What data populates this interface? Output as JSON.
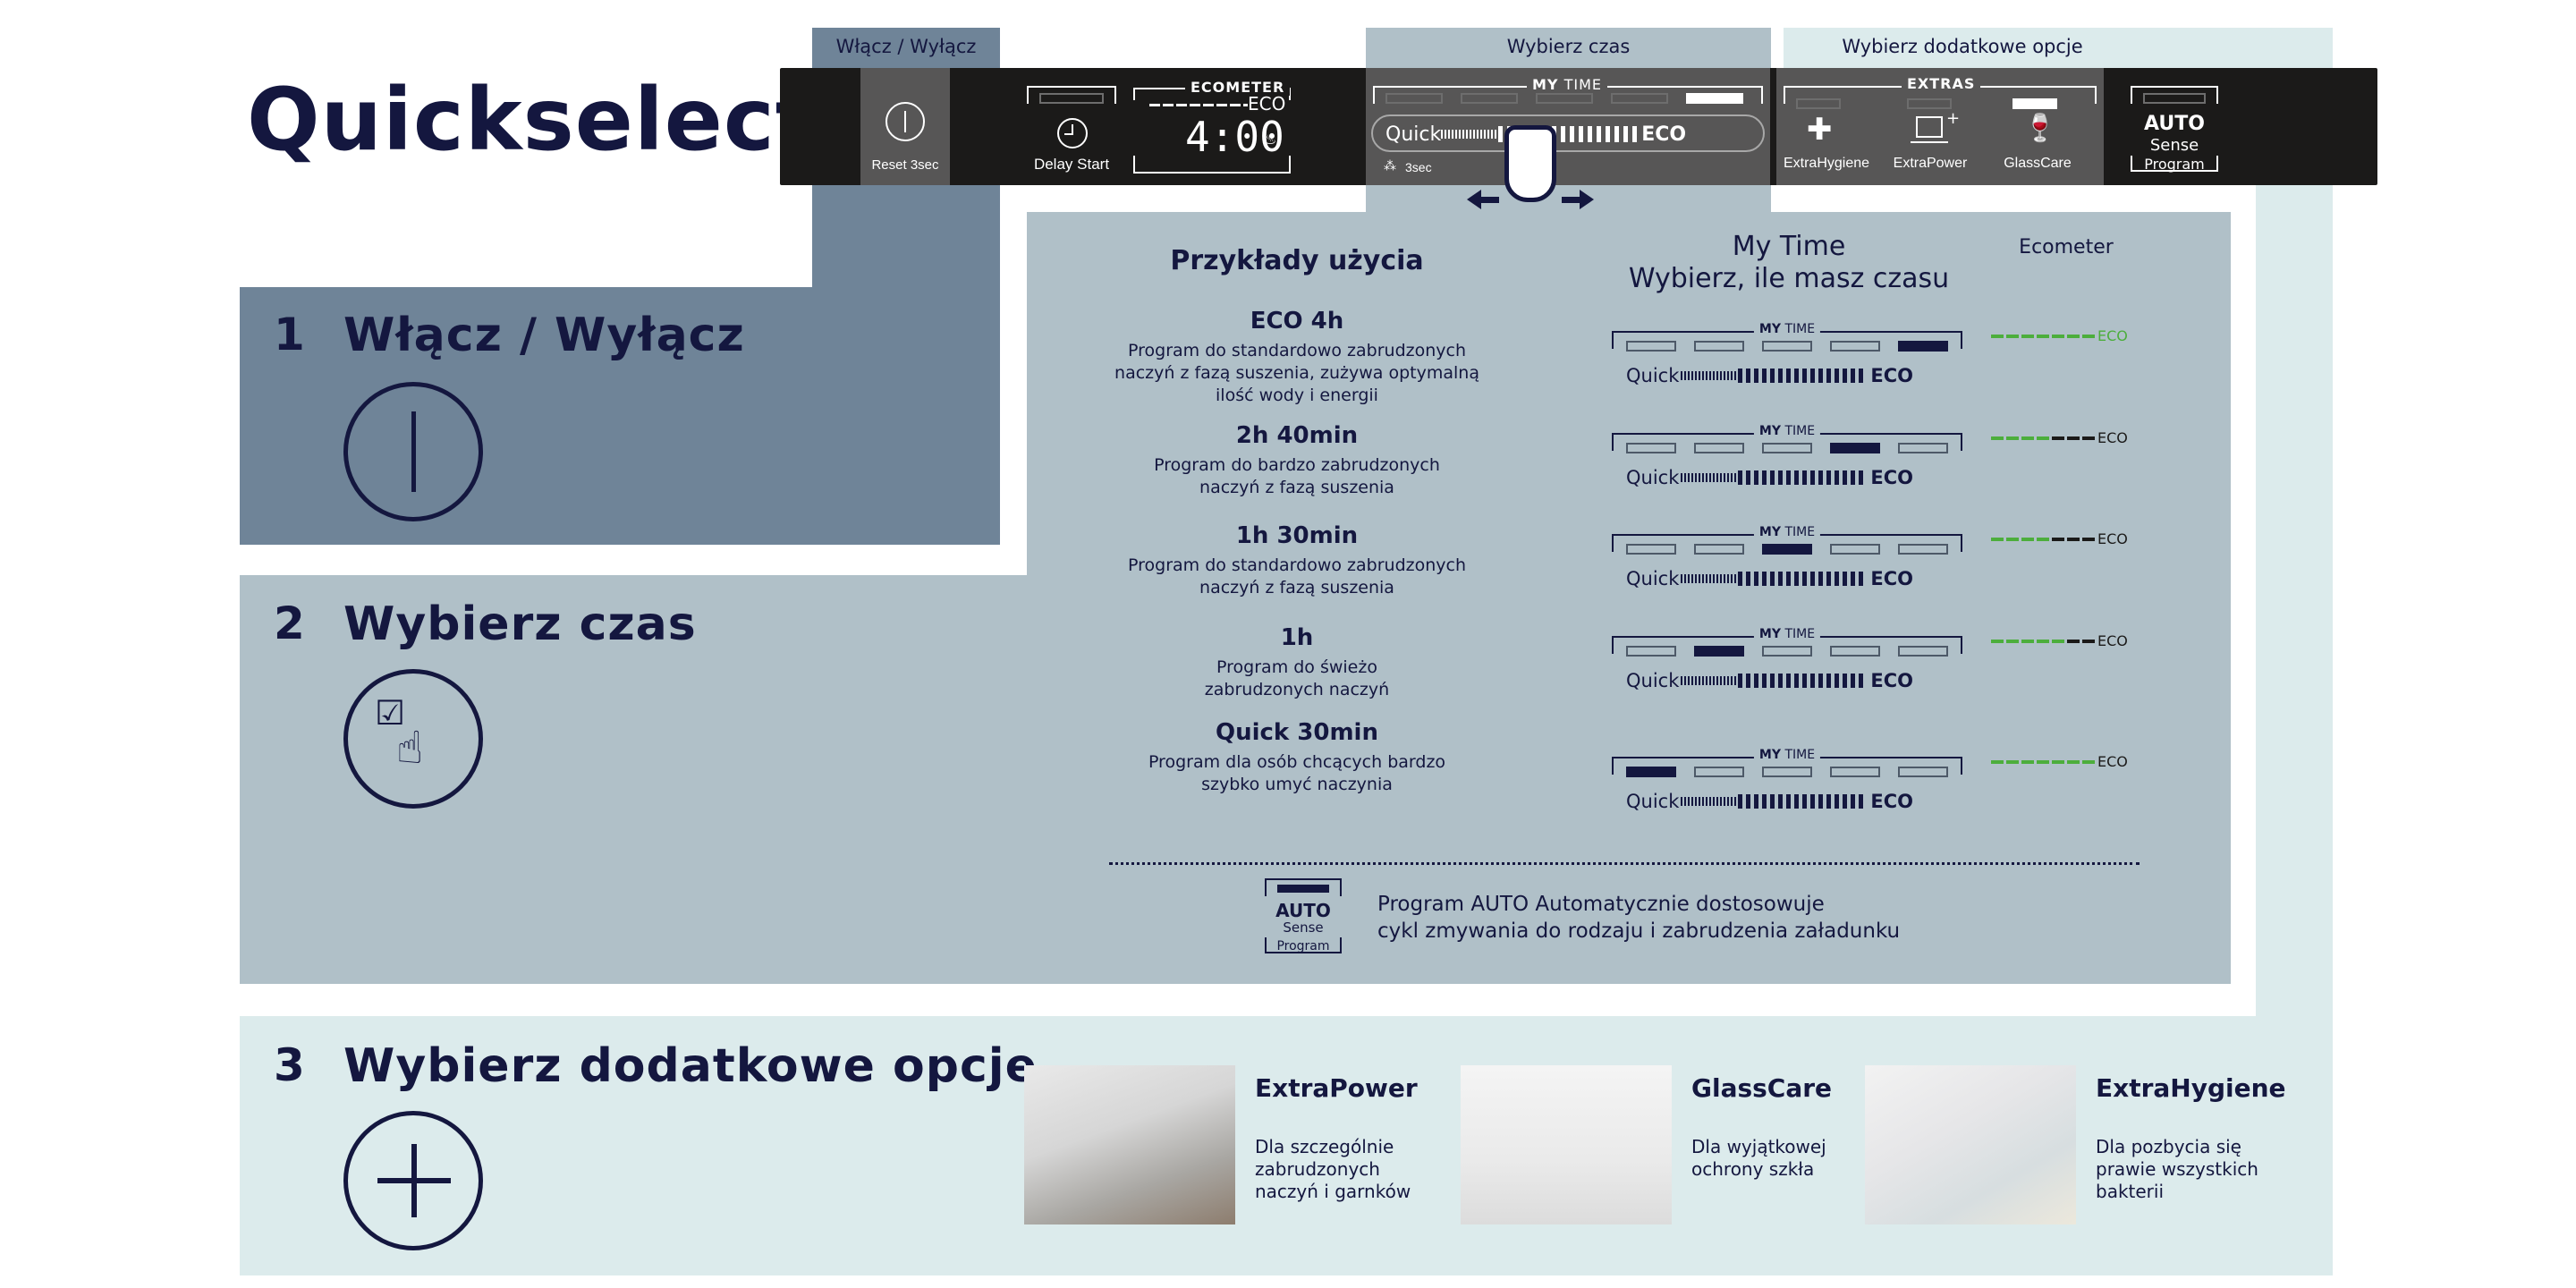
{
  "title": "Quickselect",
  "control_panel": {
    "power_header": "Włącz / Wyłącz",
    "time_header": "Wybierz czas",
    "options_header": "Wybierz dodatkowe opcje",
    "power_button": {
      "icon": "power-icon",
      "label": "Reset 3sec"
    },
    "delay_start": {
      "icon": "clock-icon",
      "label": "Delay Start",
      "indicator_on": false
    },
    "ecometer_display": {
      "label": "ECOMETER",
      "eco_label": "ECO",
      "time": "4:00",
      "drying_icon": "drying-icon"
    },
    "my_time": {
      "label_bold": "MY",
      "label_regular": "TIME",
      "segments": [
        false,
        false,
        false,
        false,
        true
      ],
      "slider_left": "Quick",
      "slider_right": "ECO",
      "hold_label": "3sec",
      "hold_icon": "spray-icon",
      "gesture_icon": "swipe-hand-icon"
    },
    "extras": {
      "label": "EXTRAS",
      "items": [
        {
          "icon": "extra-hygiene-icon",
          "label": "ExtraHygiene",
          "on": false
        },
        {
          "icon": "extra-power-icon",
          "label": "ExtraPower",
          "on": false
        },
        {
          "icon": "glass-care-icon",
          "label": "GlassCare",
          "on": true
        }
      ]
    },
    "auto_program": {
      "line1": "AUTO",
      "line2": "Sense",
      "line3": "Program",
      "indicator_on": false
    }
  },
  "sections": [
    {
      "number": "1",
      "title": "Włącz / Wyłącz",
      "icon": "power-icon"
    },
    {
      "number": "2",
      "title": "Wybierz czas",
      "icon": "touch-select-icon"
    },
    {
      "number": "3",
      "title": "Wybierz dodatkowe opcje",
      "icon": "plus-icon"
    }
  ],
  "examples": {
    "header": "Przykłady użycia",
    "my_time_header": "My Time",
    "my_time_subheader": "Wybierz, ile masz czasu",
    "ecometer_header": "Ecometer",
    "scale_left": "Quick",
    "scale_right": "ECO",
    "box_label_bold": "MY",
    "box_label_regular": "TIME",
    "ecometer_eco": "ECO",
    "rows": [
      {
        "title": "ECO 4h",
        "lines": [
          "Program do standardowo zabrudzonych",
          "naczyń z fazą suszenia, zużywa optymalną",
          "ilość wody i energii"
        ],
        "segment": 5,
        "ecometer_green": 7,
        "ecometer_total": 7,
        "eco_green": true
      },
      {
        "title": "2h 40min",
        "lines": [
          "Program do bardzo zabrudzonych",
          "naczyń z fazą suszenia"
        ],
        "segment": 4,
        "ecometer_green": 4,
        "ecometer_total": 7,
        "eco_green": false
      },
      {
        "title": "1h 30min",
        "lines": [
          "Program do standardowo zabrudzonych",
          "naczyń z fazą suszenia"
        ],
        "segment": 3,
        "ecometer_green": 4,
        "ecometer_total": 7,
        "eco_green": false
      },
      {
        "title": "1h",
        "lines": [
          "Program do świeżo",
          "zabrudzonych naczyń"
        ],
        "segment": 2,
        "ecometer_green": 5,
        "ecometer_total": 7,
        "eco_green": false
      },
      {
        "title": "Quick 30min",
        "lines": [
          "Program dla osób chcących bardzo",
          "szybko umyć naczynia"
        ],
        "segment": 1,
        "ecometer_green": 7,
        "ecometer_total": 7,
        "eco_green": false
      }
    ],
    "auto": {
      "line1": "AUTO",
      "line2": "Sense",
      "line3": "Program",
      "text": [
        "Program AUTO Automatycznie dostosowuje",
        "cykl zmywania do rodzaju i zabrudzenia  załadunku"
      ]
    }
  },
  "options": [
    {
      "title": "ExtraPower",
      "lines": [
        "Dla szczególnie",
        "zabrudzonych",
        "naczyń i garnków"
      ],
      "image": "dishes-and-pots-photo"
    },
    {
      "title": "GlassCare",
      "lines": [
        "Dla wyjątkowej",
        "ochrony szkła"
      ],
      "image": "champagne-glasses-photo"
    },
    {
      "title": "ExtraHygiene",
      "lines": [
        "Dla pozbycia się",
        "prawie wszystkich",
        "bakterii"
      ],
      "image": "baby-bottles-photo"
    }
  ],
  "colors": {
    "navy": "#14173f",
    "steel_panel": "#6f8498",
    "grey_panel": "#b0c0c8",
    "pale_panel": "#dcebec",
    "bar_black": "#1b1a19",
    "bar_grey": "#575656",
    "eco_green": "#4cae3c"
  }
}
